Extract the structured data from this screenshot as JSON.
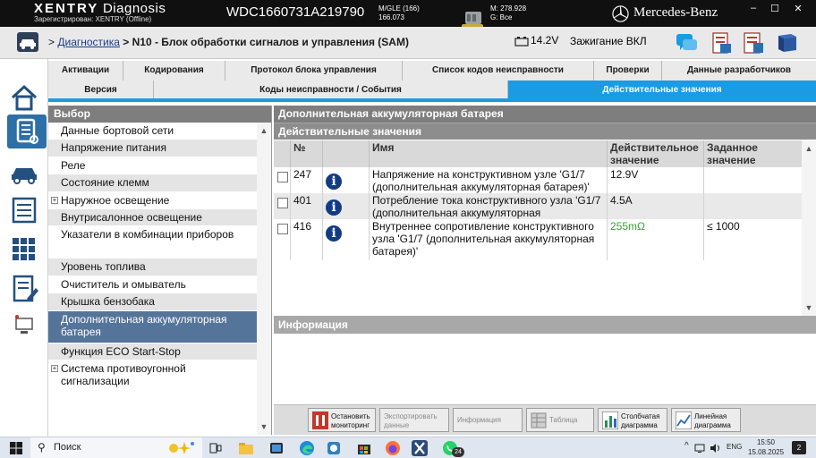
{
  "titlebar": {
    "brand": "XENTRY",
    "brand_suffix": "Diagnosis",
    "registered": "Зарегистрирован: XENTRY (Offline)",
    "vin": "WDC1660731A219790",
    "model_line1": "M/GLE (166)",
    "model_line2": "166.073",
    "mileage_line1": "M: 278.928",
    "mileage_line2": "G: Все",
    "brand_name": "Mercedes-Benz",
    "min_glyph": "–",
    "max_glyph": "☐",
    "close_glyph": "✕"
  },
  "breadcrumb": {
    "sep": ">",
    "link": "Диагностика",
    "current": "> N10 - Блок обработки сигналов и управления (SAM)",
    "voltage": "14.2V",
    "ignition": "Зажигание ВКЛ"
  },
  "tabs_row1": [
    "Активации",
    "Кодирования",
    "Протокол блока управления",
    "Список кодов неисправности",
    "Проверки",
    "Данные разработчиков"
  ],
  "tabs_row2": [
    "Версия",
    "Коды неисправности / События",
    "Действительные значения"
  ],
  "left_panel": {
    "title": "Выбор",
    "items": [
      {
        "label": "Данные бортовой сети",
        "expandable": false
      },
      {
        "label": "Напряжение питания",
        "expandable": false
      },
      {
        "label": "Реле",
        "expandable": false
      },
      {
        "label": "Состояние клемм",
        "expandable": false
      },
      {
        "label": "Наружное освещение",
        "expandable": true
      },
      {
        "label": "Внутрисалонное освещение",
        "expandable": false
      },
      {
        "label": "Указатели в комбинации приборов",
        "expandable": false
      },
      {
        "label": "Уровень топлива",
        "expandable": false
      },
      {
        "label": "Очиститель и омыватель",
        "expandable": false
      },
      {
        "label": "Крышка бензобака",
        "expandable": false
      },
      {
        "label": "Дополнительная аккумуляторная батарея",
        "expandable": false,
        "selected": true
      },
      {
        "label": "Функция ECO Start-Stop",
        "expandable": false
      },
      {
        "label": "Система противоугонной сигнализации",
        "expandable": true
      }
    ],
    "expander_glyph": "+",
    "scroll_up": "▲",
    "scroll_down": "▼"
  },
  "right_panel": {
    "title": "Дополнительная аккумуляторная батарея",
    "subtitle": "Действительные значения",
    "columns": {
      "num": "№",
      "name": "Имя",
      "actual": "Действительное значение",
      "target": "Заданное значение"
    },
    "rows": [
      {
        "num": "247",
        "name": "Напряжение на конструктивном узле 'G1/7 (дополнительная аккумуляторная батарея)'",
        "actual": "12.9V",
        "target": "",
        "actual_ok": false
      },
      {
        "num": "401",
        "name": "Потребление тока конструктивного узла 'G1/7 (дополнительная аккумуляторная",
        "actual": "4.5A",
        "target": "",
        "actual_ok": false
      },
      {
        "num": "416",
        "name": "Внутреннее сопротивление конструктивного узла 'G1/7 (дополнительная аккумуляторная батарея)'",
        "actual": "255mΩ",
        "target": "≤ 1000",
        "actual_ok": true
      }
    ],
    "info_icon_glyph": "i",
    "info_header": "Информация",
    "scroll_up": "▲",
    "scroll_down": "▼"
  },
  "bottom_toolbar": {
    "stop": "Остановить мониторинг",
    "export": "Экспортировать данные",
    "info": "Информация",
    "table": "Таблица",
    "bar": "Столбчатая диаграмма",
    "line": "Линейная диаграмма"
  },
  "taskbar": {
    "search": "Поиск",
    "search_glyph": "⚲",
    "lang": "ENG",
    "time": "15:50",
    "date": "15.08.2025",
    "whatsapp_badge": "24",
    "tray_arrow": "^",
    "notif_count": "2"
  },
  "colors": {
    "accent": "#1a9be3",
    "selection": "#55749a",
    "title_bg": "#101010",
    "ok_value": "#3aa13a"
  }
}
